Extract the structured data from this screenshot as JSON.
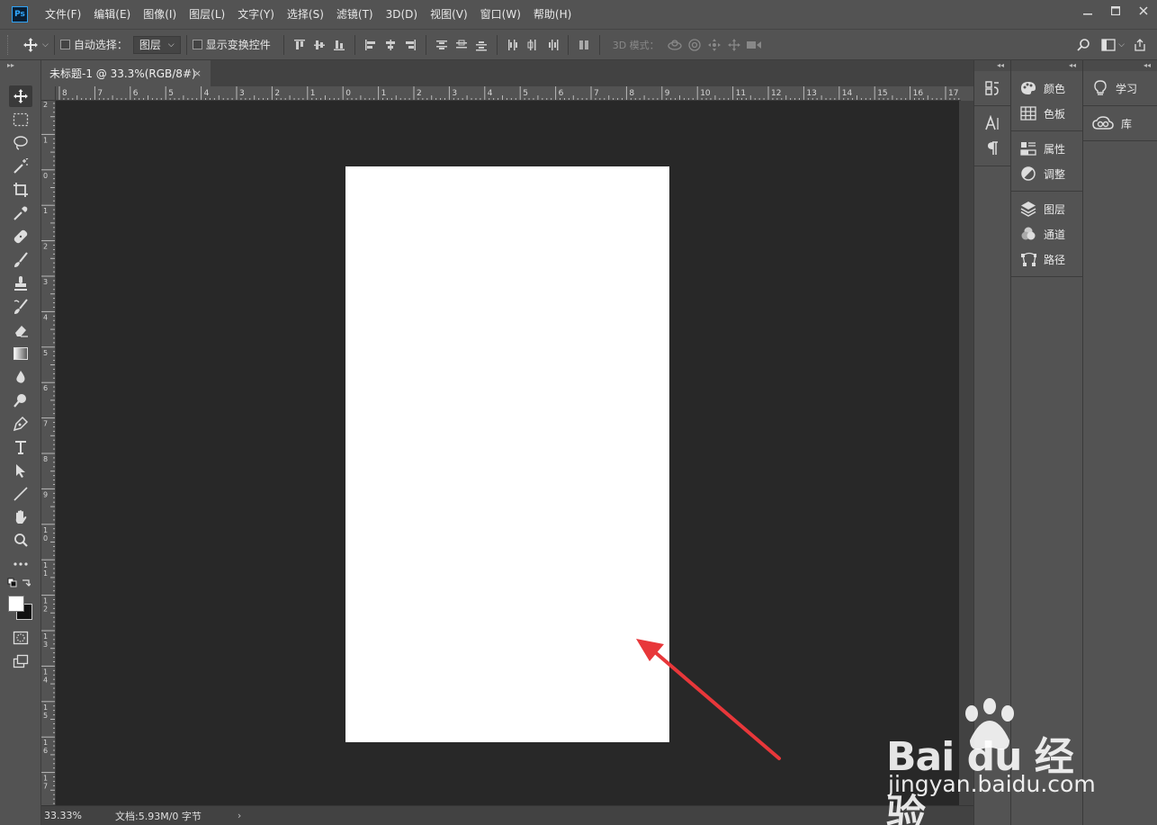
{
  "app": {
    "logo_text": "Ps"
  },
  "menu": [
    {
      "label": "文件(F)"
    },
    {
      "label": "编辑(E)"
    },
    {
      "label": "图像(I)"
    },
    {
      "label": "图层(L)"
    },
    {
      "label": "文字(Y)"
    },
    {
      "label": "选择(S)"
    },
    {
      "label": "滤镜(T)"
    },
    {
      "label": "3D(D)"
    },
    {
      "label": "视图(V)"
    },
    {
      "label": "窗口(W)"
    },
    {
      "label": "帮助(H)"
    }
  ],
  "options": {
    "auto_select_label": "自动选择：",
    "auto_select_value": "图层",
    "show_transform_label": "显示变换控件",
    "mode_3d_label": "3D 模式："
  },
  "document": {
    "tab_title": "未标题-1 @ 33.3%(RGB/8#)",
    "close_glyph": "×",
    "canvas_color": "#ffffff",
    "pasteboard_color": "#282828"
  },
  "ruler": {
    "h_labels": [
      "8",
      "7",
      "6",
      "5",
      "4",
      "3",
      "2",
      "1",
      "0",
      "1",
      "2",
      "3",
      "4",
      "5",
      "6",
      "7",
      "8",
      "9",
      "10",
      "11",
      "12",
      "13",
      "14",
      "15",
      "16",
      "17"
    ],
    "v_labels": [
      "2",
      "1",
      "0",
      "1",
      "2",
      "3",
      "4",
      "5",
      "6",
      "7",
      "8",
      "9",
      "10",
      "11",
      "12",
      "13",
      "14",
      "15",
      "16",
      "17"
    ]
  },
  "status": {
    "zoom": "33.33%",
    "doc_info": "文档:5.93M/0 字节",
    "arrow": "›"
  },
  "panels": {
    "col2_groups": [
      [
        {
          "label": "颜色",
          "icon": "palette-icon"
        },
        {
          "label": "色板",
          "icon": "swatches-grid-icon"
        }
      ],
      [
        {
          "label": "属性",
          "icon": "properties-icon"
        },
        {
          "label": "调整",
          "icon": "adjustments-icon"
        }
      ],
      [
        {
          "label": "图层",
          "icon": "layers-icon"
        },
        {
          "label": "通道",
          "icon": "channels-icon"
        },
        {
          "label": "路径",
          "icon": "paths-icon"
        }
      ]
    ],
    "col3": [
      {
        "label": "学习",
        "icon": "lightbulb-icon"
      },
      {
        "label": "库",
        "icon": "cc-libraries-icon"
      }
    ]
  },
  "colors": {
    "annotation_arrow": "#e8373a",
    "ui_bg": "#535353",
    "accent": "#31a8ff"
  },
  "watermark": {
    "logo": "Bai du 经验",
    "url": "jingyan.baidu.com"
  }
}
